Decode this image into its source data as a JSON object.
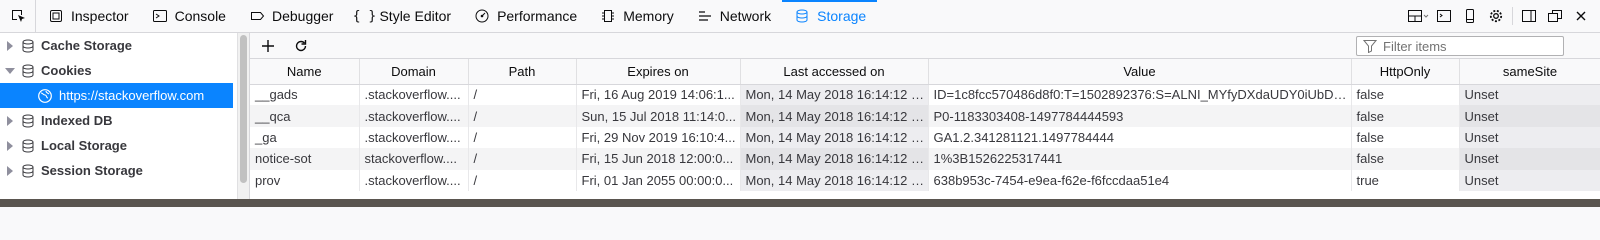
{
  "toolbar": {
    "tabs": [
      {
        "label": "Inspector",
        "icon": "inspector-icon"
      },
      {
        "label": "Console",
        "icon": "console-icon"
      },
      {
        "label": "Debugger",
        "icon": "debugger-icon"
      },
      {
        "label": "Style Editor",
        "icon": "style-editor-icon"
      },
      {
        "label": "Performance",
        "icon": "performance-icon"
      },
      {
        "label": "Memory",
        "icon": "memory-icon"
      },
      {
        "label": "Network",
        "icon": "network-icon"
      },
      {
        "label": "Storage",
        "icon": "storage-icon",
        "selected": true
      }
    ],
    "accent_color": "#0a84ff"
  },
  "sidebar": {
    "items": [
      {
        "label": "Cache Storage",
        "expanded": false
      },
      {
        "label": "Cookies",
        "expanded": true
      },
      {
        "label": "https://stackoverflow.com",
        "selected": true
      },
      {
        "label": "Indexed DB",
        "expanded": false
      },
      {
        "label": "Local Storage",
        "expanded": false
      },
      {
        "label": "Session Storage",
        "expanded": false
      }
    ]
  },
  "filter": {
    "placeholder": "Filter items"
  },
  "table": {
    "columns": [
      "Name",
      "Domain",
      "Path",
      "Expires on",
      "Last accessed on",
      "Value",
      "HttpOnly",
      "sameSite"
    ],
    "rows": [
      [
        "__gads",
        ".stackoverflow....",
        "/",
        "Fri, 16 Aug 2019 14:06:1...",
        "Mon, 14 May 2018 16:14:12 G...",
        "ID=1c8fcc570486d8f0:T=1502892376:S=ALNI_MYfyDXdaUDY0iUbD6...",
        "false",
        "Unset"
      ],
      [
        "__qca",
        ".stackoverflow....",
        "/",
        "Sun, 15 Jul 2018 11:14:0...",
        "Mon, 14 May 2018 16:14:12 G...",
        "P0-1183303408-1497784444593",
        "false",
        "Unset"
      ],
      [
        "_ga",
        ".stackoverflow....",
        "/",
        "Fri, 29 Nov 2019 16:10:4...",
        "Mon, 14 May 2018 16:14:12 G...",
        "GA1.2.341281121.1497784444",
        "false",
        "Unset"
      ],
      [
        "notice-sot",
        "stackoverflow....",
        "/",
        "Fri, 15 Jun 2018 12:00:0...",
        "Mon, 14 May 2018 16:14:12 G...",
        "1%3B1526225317441",
        "false",
        "Unset"
      ],
      [
        "prov",
        ".stackoverflow....",
        "/",
        "Fri, 01 Jan 2055 00:00:0...",
        "Mon, 14 May 2018 16:14:12 G...",
        "638b953c-7454-e9ea-f62e-f6fccdaa51e4",
        "true",
        "Unset"
      ]
    ]
  }
}
